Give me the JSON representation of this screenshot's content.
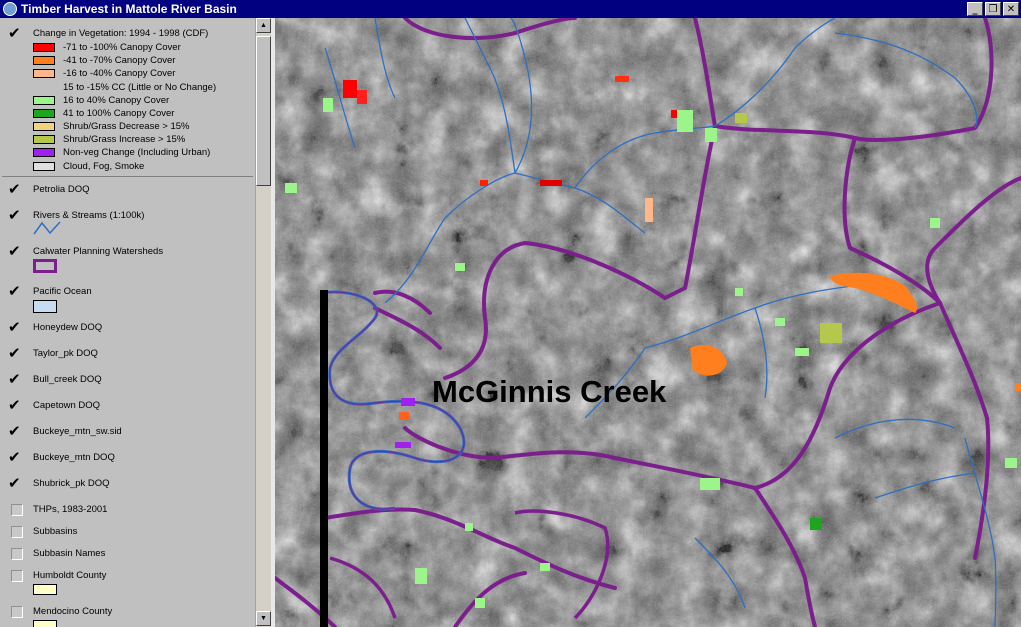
{
  "window": {
    "title": "Timber Harvest in Mattole River Basin",
    "buttons": [
      "_",
      "❐",
      "✕"
    ]
  },
  "legend": {
    "vegetation_layer": {
      "title": "Change in Vegetation: 1994 - 1998 (CDF)",
      "checked": true,
      "classes": [
        {
          "label": "-71 to -100% Canopy Cover",
          "color": "#ff0000"
        },
        {
          "label": "-41 to -70% Canopy Cover",
          "color": "#ff7f1e"
        },
        {
          "label": "-16 to -40% Canopy Cover",
          "color": "#ffb78a"
        },
        {
          "label": "15 to -15% CC (Little or No Change)",
          "color": "none"
        },
        {
          "label": "16 to 40% Canopy Cover",
          "color": "#9cf58a"
        },
        {
          "label": "41 to 100% Canopy Cover",
          "color": "#1ea51e"
        },
        {
          "label": "Shrub/Grass Decrease > 15%",
          "color": "#f2d27a"
        },
        {
          "label": "Shrub/Grass Increase > 15%",
          "color": "#b5c84b"
        },
        {
          "label": "Non-veg Change (Including Urban)",
          "color": "#a020f0"
        },
        {
          "label": "Cloud, Fog, Smoke",
          "color": "#e0e0e0"
        }
      ]
    },
    "layers": [
      {
        "label": "Petrolia DOQ",
        "checked": true
      },
      {
        "label": "Rivers & Streams (1:100k)",
        "checked": true,
        "symbol": "river-line"
      },
      {
        "label": "Calwater Planning Watersheds",
        "checked": true,
        "symbol": "watershed-box"
      },
      {
        "label": "Pacific Ocean",
        "checked": true,
        "symbol": "ocean-box"
      },
      {
        "label": "Honeydew DOQ",
        "checked": true
      },
      {
        "label": "Taylor_pk DOQ",
        "checked": true
      },
      {
        "label": "Bull_creek DOQ",
        "checked": true
      },
      {
        "label": "Capetown DOQ",
        "checked": true
      },
      {
        "label": "Buckeye_mtn_sw.sid",
        "checked": true
      },
      {
        "label": "Buckeye_mtn DOQ",
        "checked": true
      },
      {
        "label": "Shubrick_pk DOQ",
        "checked": true
      },
      {
        "label": "THPs, 1983-2001",
        "checked": false
      },
      {
        "label": "Subbasins",
        "checked": false
      },
      {
        "label": "Subbasin Names",
        "checked": false
      },
      {
        "label": "Humboldt County",
        "checked": false,
        "symbol": "county-box"
      },
      {
        "label": "Mendocino County",
        "checked": false,
        "symbol": "county-box"
      }
    ]
  },
  "map": {
    "label": "McGinnis Creek",
    "colors": {
      "watershed": "#7b1f8c",
      "river": "#2d6fc4",
      "ocean": "#c6dcf0",
      "county": "#ffffc8"
    }
  }
}
